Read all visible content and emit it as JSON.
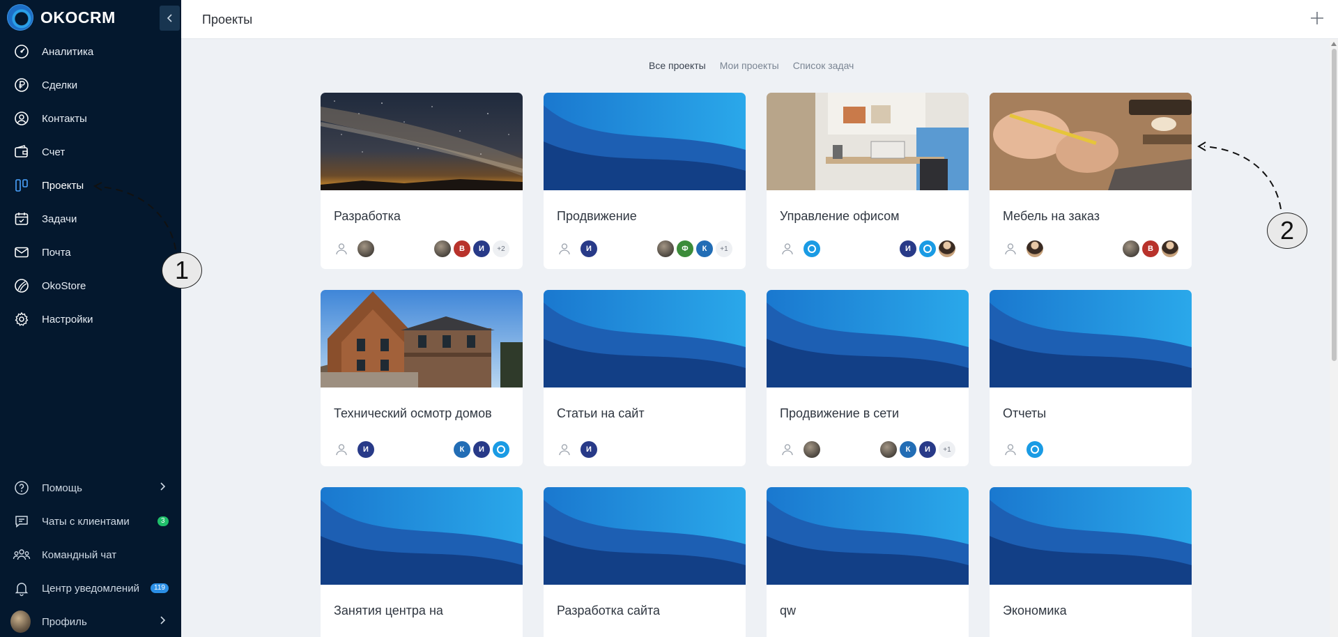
{
  "app": {
    "logo_text": "OKOCRM"
  },
  "header": {
    "title": "Проекты",
    "add_icon": "plus-icon"
  },
  "sidebar": {
    "items": [
      {
        "label": "Аналитика",
        "icon": "gauge-icon"
      },
      {
        "label": "Сделки",
        "icon": "ruble-icon"
      },
      {
        "label": "Контакты",
        "icon": "user-circle-icon"
      },
      {
        "label": "Счет",
        "icon": "wallet-icon"
      },
      {
        "label": "Проекты",
        "icon": "kanban-icon",
        "active": true
      },
      {
        "label": "Задачи",
        "icon": "calendar-check-icon"
      },
      {
        "label": "Почта",
        "icon": "mail-icon"
      },
      {
        "label": "OkoStore",
        "icon": "store-icon"
      },
      {
        "label": "Настройки",
        "icon": "gear-icon"
      }
    ],
    "bottom": [
      {
        "label": "Помощь",
        "icon": "help-icon"
      },
      {
        "label": "Чаты с клиентами",
        "icon": "chat-icon",
        "badge": "3"
      },
      {
        "label": "Командный чат",
        "icon": "team-icon"
      },
      {
        "label": "Центр уведомлений",
        "icon": "bell-icon",
        "badge": "119"
      },
      {
        "label": "Профиль",
        "icon": "avatar"
      }
    ]
  },
  "tabs": [
    "Все проекты",
    "Мои проекты",
    "Список задач"
  ],
  "projects": [
    {
      "title": "Разработка",
      "cover": "milky-way-photo"
    },
    {
      "title": "Продвижение",
      "cover": "blue-wave"
    },
    {
      "title": "Управление офисом",
      "cover": "office-desk-photo"
    },
    {
      "title": "Мебель на заказ",
      "cover": "woodwork-photo"
    },
    {
      "title": "Технический осмотр домов",
      "cover": "wooden-house-photo"
    },
    {
      "title": "Статьи на сайт",
      "cover": "blue-wave"
    },
    {
      "title": "Продвижение в сети",
      "cover": "blue-wave"
    },
    {
      "title": "Отчеты",
      "cover": "blue-wave"
    },
    {
      "title": "Занятия центра на",
      "cover": "blue-wave"
    },
    {
      "title": "Разработка сайта",
      "cover": "blue-wave"
    },
    {
      "title": "qw",
      "cover": "blue-wave"
    },
    {
      "title": "Экономика",
      "cover": "blue-wave"
    }
  ],
  "avatars": {
    "p1_members_b": "В",
    "p1_members_c": "И",
    "p1_more": "+2",
    "p2_owner": "И",
    "p2_members_b": "Ф",
    "p2_members_c": "К",
    "p2_more": "+1",
    "p3_members_a": "И",
    "p4_members_b": "В",
    "p5_owner": "И",
    "p5_members_a": "К",
    "p5_members_b": "И",
    "p6_owner": "И",
    "p7_members_b": "К",
    "p7_members_c": "И",
    "p7_more": "+1"
  },
  "annotations": [
    "1",
    "2"
  ],
  "colors": {
    "sidebar_bg": "#04182e",
    "accent": "#1a9be4",
    "content_bg": "#eef1f5"
  }
}
